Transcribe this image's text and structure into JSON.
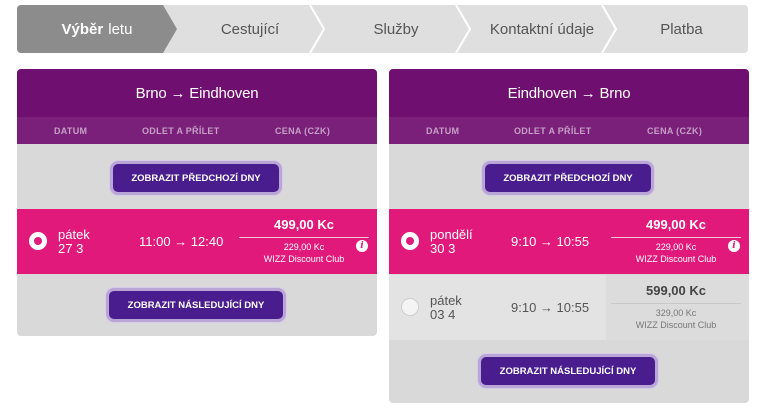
{
  "steps": [
    {
      "bold": "Výběr",
      "label": "letu"
    },
    {
      "label": "Cestující"
    },
    {
      "label": "Služby"
    },
    {
      "label": "Kontaktní údaje"
    },
    {
      "label": "Platba"
    }
  ],
  "columns": {
    "date": "DATUM",
    "times": "ODLET A PŘÍLET",
    "price": "CENA (CZK)"
  },
  "outbound": {
    "route": "Brno → Eindhoven",
    "prev_button": "ZOBRAZIT PŘEDCHOZÍ DNY",
    "next_button": "ZOBRAZIT NÁSLEDUJÍCÍ DNY",
    "flights": [
      {
        "weekday": "pátek",
        "date": "27 3",
        "times": "11:00 → 12:40",
        "price": "499,00 Kc",
        "club_price": "229,00 Kc",
        "club_name": "WIZZ Discount Club",
        "selected": true
      }
    ]
  },
  "return": {
    "route": "Eindhoven → Brno",
    "prev_button": "ZOBRAZIT PŘEDCHOZÍ DNY",
    "next_button": "ZOBRAZIT NÁSLEDUJÍCÍ DNY",
    "flights": [
      {
        "weekday": "pondělí",
        "date": "30 3",
        "times": "9:10 → 10:55",
        "price": "499,00 Kc",
        "club_price": "229,00 Kc",
        "club_name": "WIZZ Discount Club",
        "selected": true
      },
      {
        "weekday": "pátek",
        "date": "03 4",
        "times": "9:10 → 10:55",
        "price": "599,00 Kc",
        "club_price": "329,00 Kc",
        "club_name": "WIZZ Discount Club",
        "selected": false
      }
    ]
  },
  "info_icon": "i",
  "colors": {
    "brand_purple": "#6f0f6f",
    "accent_pink": "#e0197a",
    "button_purple": "#4a1d8f"
  }
}
